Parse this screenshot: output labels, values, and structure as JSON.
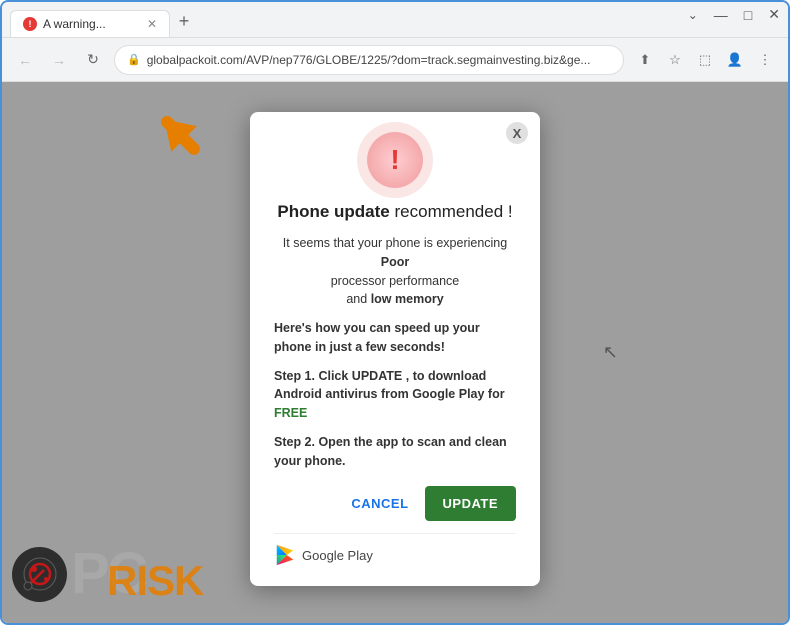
{
  "browser": {
    "tab_title": "A warning...",
    "tab_favicon": "!",
    "address": "globalpackoit.com/AVP/nep776/GLOBE/1225/?dom=track.segmainvesting.biz&ge...",
    "nav": {
      "back": "←",
      "forward": "→",
      "reload": "↻"
    }
  },
  "window_controls": {
    "minimize": "—",
    "maximize": "□",
    "close": "✕"
  },
  "modal": {
    "close_label": "X",
    "title_bold": "Phone update",
    "title_rest": "recommended !",
    "body_line1": "It seems that your phone is experiencing",
    "body_bold1": "Poor",
    "body_line2": "processor performance",
    "body_line3": "and",
    "body_bold2": "low memory",
    "speed_title": "Here's how you can speed up your phone in just a few seconds!",
    "step1": "Step 1. Click UPDATE , to download Android antivirus from Google Play for",
    "step1_free": "FREE",
    "step2": "Step 2. Open the app to scan and clean your phone.",
    "cancel_label": "CANCEL",
    "update_label": "UPDATE",
    "google_play_label": "Google Play"
  },
  "watermark": {
    "pc_text": "PC",
    "risk_text": "RISK"
  },
  "colors": {
    "cancel_color": "#1a73e8",
    "update_bg": "#2e7d32",
    "free_color": "#2e7d32",
    "alert_red": "#e53935"
  }
}
